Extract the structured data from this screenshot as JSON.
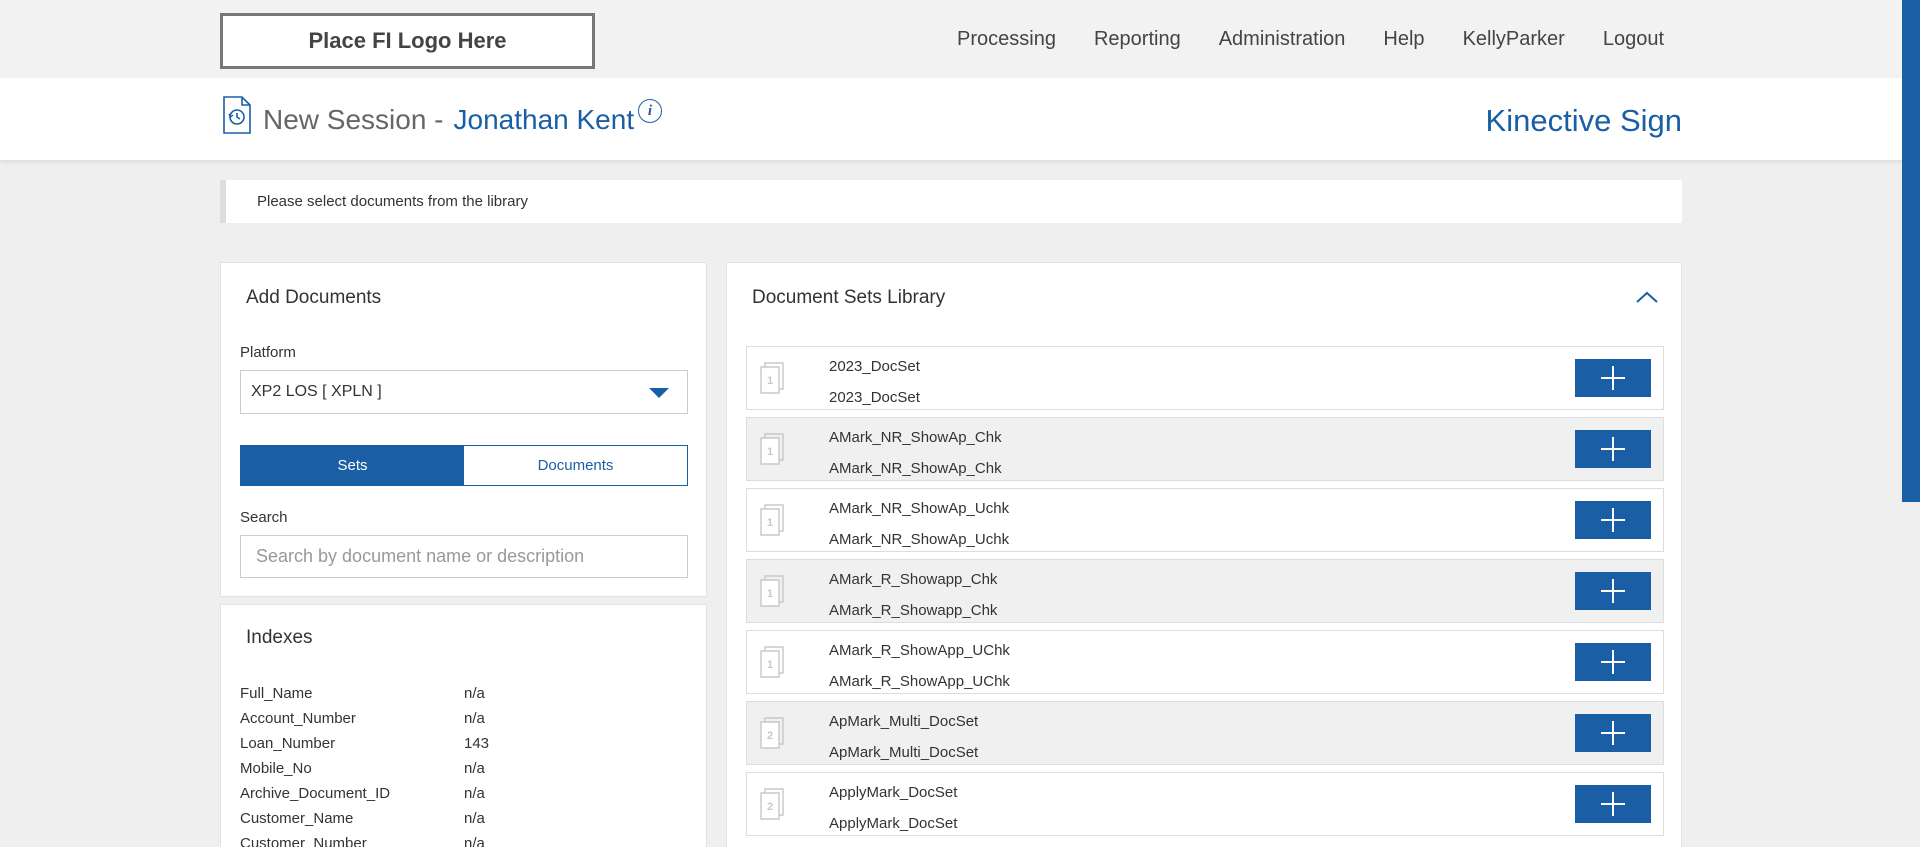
{
  "logo": {
    "text": "Place FI Logo Here"
  },
  "nav": {
    "items": [
      "Processing",
      "Reporting",
      "Administration",
      "Help",
      "KellyParker",
      "Logout"
    ]
  },
  "header": {
    "title": "New Session -",
    "name": "Jonathan Kent",
    "info_icon": "i",
    "brand": "Kinective Sign"
  },
  "notice": {
    "text": "Please select documents from the library"
  },
  "add_documents": {
    "title": "Add Documents",
    "platform_label": "Platform",
    "platform_value": "XP2 LOS [ XPLN ]",
    "toggle_sets": "Sets",
    "toggle_documents": "Documents",
    "search_label": "Search",
    "search_placeholder": "Search by document name or description"
  },
  "indexes": {
    "title": "Indexes",
    "rows": [
      {
        "key": "Full_Name",
        "value": "n/a"
      },
      {
        "key": "Account_Number",
        "value": "n/a"
      },
      {
        "key": "Loan_Number",
        "value": "143"
      },
      {
        "key": "Mobile_No",
        "value": "n/a"
      },
      {
        "key": "Archive_Document_ID",
        "value": "n/a"
      },
      {
        "key": "Customer_Name",
        "value": "n/a"
      },
      {
        "key": "Customer_Number",
        "value": "n/a"
      }
    ]
  },
  "library": {
    "title": "Document Sets Library",
    "items": [
      {
        "count": "1",
        "name": "2023_DocSet",
        "description": "2023_DocSet"
      },
      {
        "count": "1",
        "name": "AMark_NR_ShowAp_Chk",
        "description": "AMark_NR_ShowAp_Chk"
      },
      {
        "count": "1",
        "name": "AMark_NR_ShowAp_Uchk",
        "description": "AMark_NR_ShowAp_Uchk"
      },
      {
        "count": "1",
        "name": "AMark_R_Showapp_Chk",
        "description": "AMark_R_Showapp_Chk"
      },
      {
        "count": "1",
        "name": "AMark_R_ShowApp_UChk",
        "description": "AMark_R_ShowApp_UChk"
      },
      {
        "count": "2",
        "name": "ApMark_Multi_DocSet",
        "description": "ApMark_Multi_DocSet"
      },
      {
        "count": "2",
        "name": "ApplyMark_DocSet",
        "description": "ApplyMark_DocSet"
      }
    ]
  },
  "colors": {
    "accent": "#1a5fa6",
    "background": "#efefef",
    "row_alt": "#f0f0f0"
  }
}
